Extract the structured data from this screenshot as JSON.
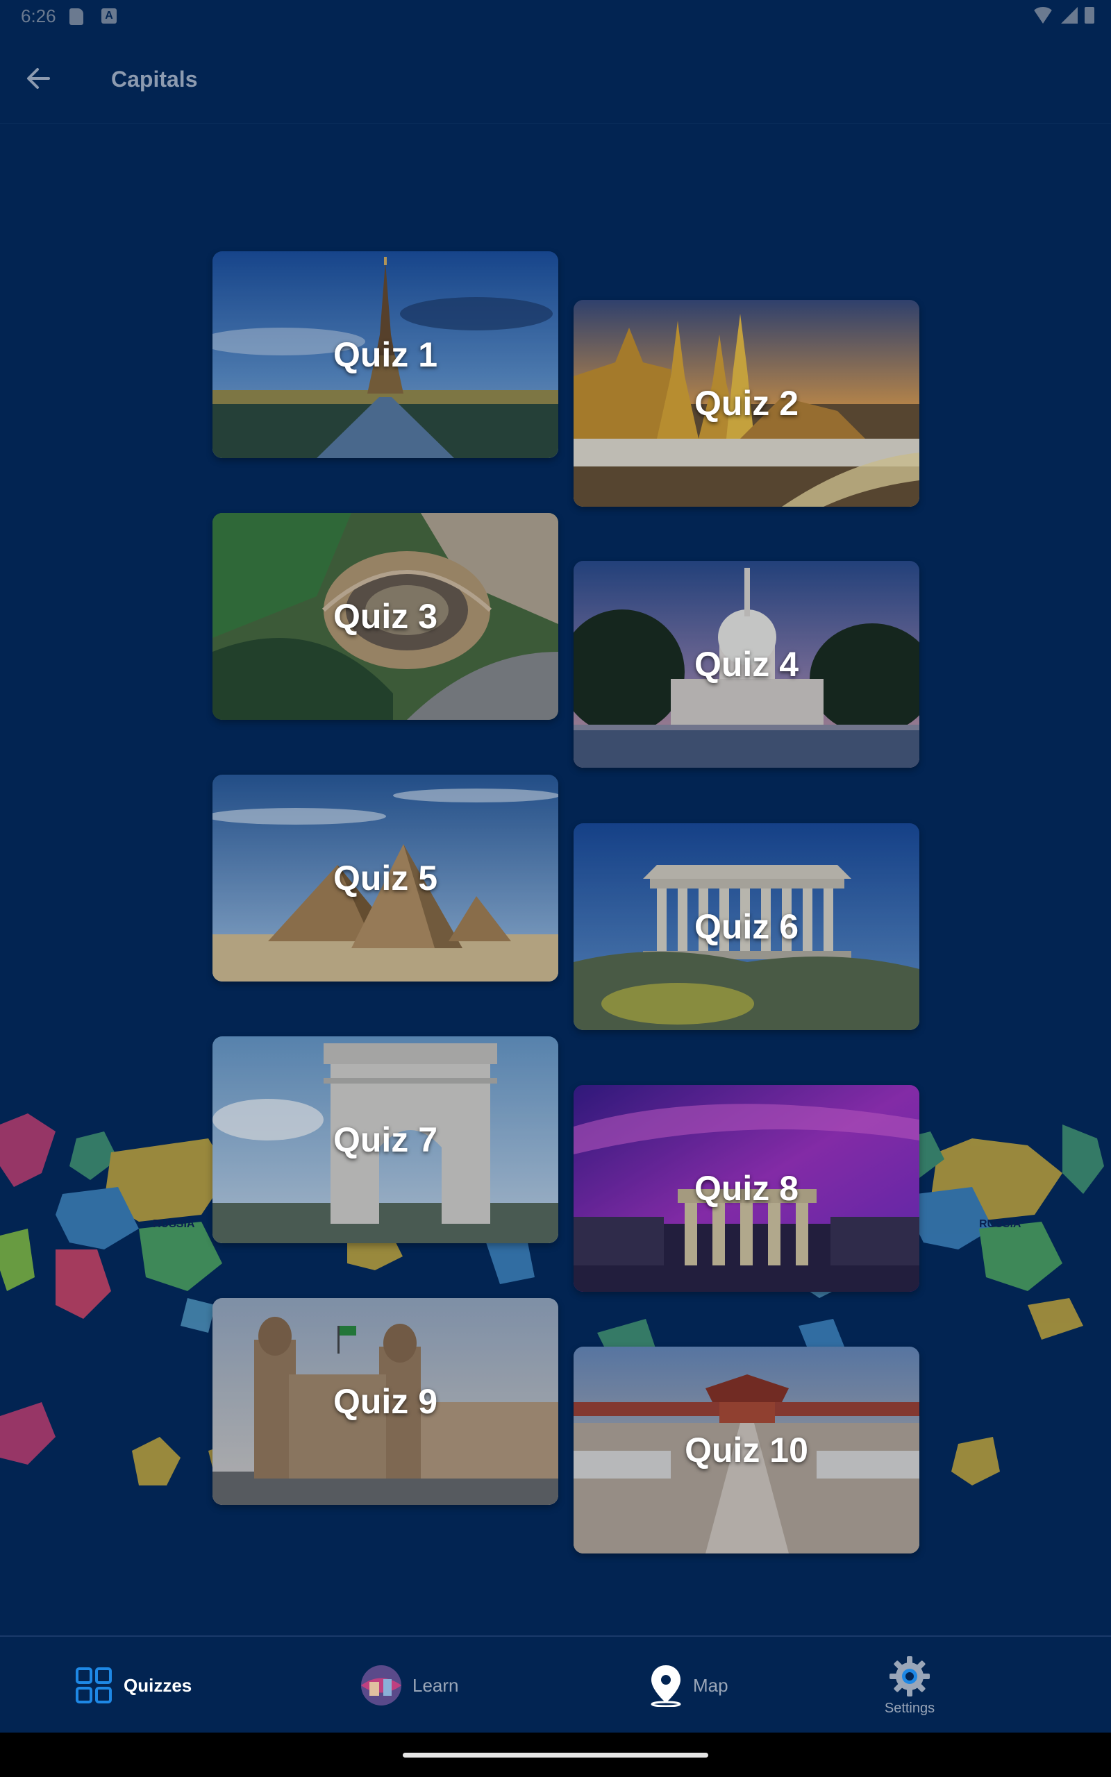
{
  "status_bar": {
    "time": "6:26"
  },
  "app_bar": {
    "title": "Capitals"
  },
  "quizzes": [
    {
      "label": "Quiz 1",
      "landmark": "eiffel-tower"
    },
    {
      "label": "Quiz 2",
      "landmark": "grand-palace"
    },
    {
      "label": "Quiz 3",
      "landmark": "colosseum"
    },
    {
      "label": "Quiz 4",
      "landmark": "us-capitol"
    },
    {
      "label": "Quiz 5",
      "landmark": "pyramids"
    },
    {
      "label": "Quiz 6",
      "landmark": "parthenon"
    },
    {
      "label": "Quiz 7",
      "landmark": "arc-de-triomphe"
    },
    {
      "label": "Quiz 8",
      "landmark": "brandenburg-gate"
    },
    {
      "label": "Quiz 9",
      "landmark": "mexico-city-cathedral"
    },
    {
      "label": "Quiz 10",
      "landmark": "forbidden-city"
    }
  ],
  "map_labels": {
    "russia": "RUSSIA"
  },
  "bottom_nav": {
    "items": [
      {
        "label": "Quizzes",
        "icon": "grid-icon",
        "active": true
      },
      {
        "label": "Learn",
        "icon": "globe-icon",
        "active": false
      },
      {
        "label": "Map",
        "icon": "map-pin-icon",
        "active": false
      },
      {
        "label": "Settings",
        "icon": "gear-icon",
        "active": false
      }
    ]
  },
  "colors": {
    "background": "#022452",
    "accent": "#1e88e5"
  }
}
